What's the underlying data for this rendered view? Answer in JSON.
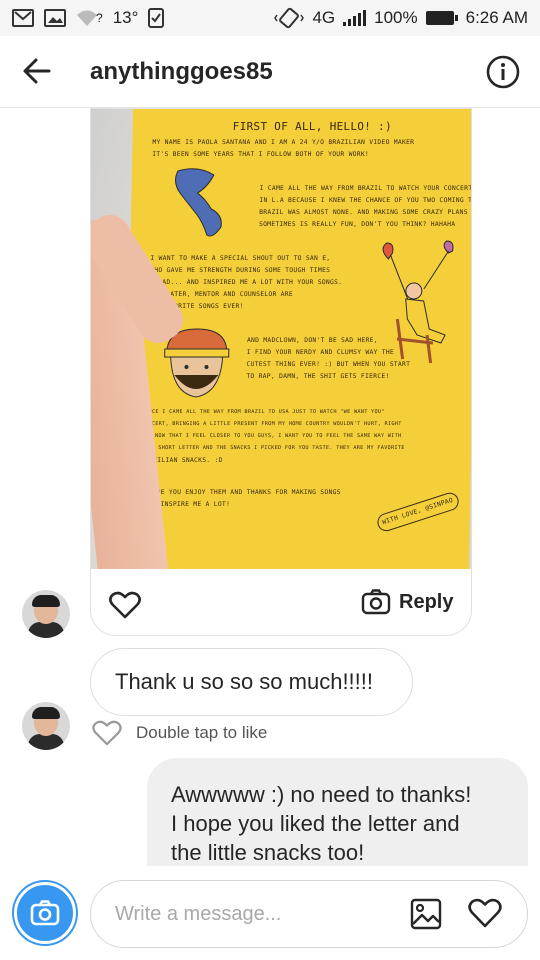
{
  "status_bar": {
    "signal_question": "?",
    "temperature": "13°",
    "network": "4G",
    "battery": "100%",
    "time": "6:26 AM"
  },
  "header": {
    "username": "anythinggoes85",
    "back_icon": "arrow-left-icon",
    "info_icon": "info-circle-icon"
  },
  "letter": {
    "date_line": "",
    "body_lines": [
      "FIRST OF ALL, HELLO! :)",
      "MY NAME IS PAOLA SANTANA AND I AM A 24 Y/O BRAZILIAN VIDEO MAKER",
      "IT'S BEEN SOME YEARS THAT I FOLLOW BOTH OF YOUR WORK!",
      "I CAME ALL THE WAY FROM BRAZIL TO WATCH YOUR CONCERT",
      "IN L.A BECAUSE I KNEW THE CHANCE OF YOU TWO COMING TO",
      "BRAZIL WAS ALMOST NONE. AND MAKING SOME CRAZY PLANS",
      "SOMETIMES IS REALLY FUN, DON'T YOU THINK? HAHAHA",
      "I WANT TO MAKE A SPECIAL SHOUT OUT TO SAN E,",
      "WHO GAVE ME STRENGTH DURING SOME TOUGH TIMES",
      "I HAD... AND INSPIRED ME A LOT WITH YOUR SONGS.",
      "LUVWRATER, MENTOR AND COUNSELOR ARE",
      "MY FAVORITE SONGS EVER!",
      "AND MADCLOWN, DON'T BE SAD HERE,",
      "I FIND YOUR NERDY AND CLUMSY WAY THE",
      "CUTEST THING EVER! :) BUT WHEN YOU START",
      "TO RAP, DAMN, THE SHIT GETS FIERCE!",
      "SINCE I CAME ALL THE WAY FROM BRAZIL TO USA JUST TO WATCH \"WE WANT YOU\"",
      "CONCERT, BRINGING A LITTLE PRESENT FROM MY HOME COUNTRY WOULDN'T HURT, RIGHT",
      "SO, NOW THAT I FEEL CLOSER TO YOU GUYS, I WANT YOU TO FEEL THE SAME WAY WITH",
      "THIS SHORT LETTER AND THE SNACKS I PICKED FOR YOU TASTE. THEY ARE MY FAVORITE",
      "BRAZILIAN SNACKS. :D",
      "I HOPE YOU ENJOY THEM AND THANKS FOR MAKING SONGS",
      "THAT INSPIRE ME A LOT!",
      "WITH LOVE, @SINPAO"
    ]
  },
  "image_message": {
    "heart_icon": "heart-outline-icon",
    "reply_icon": "camera-outline-icon",
    "reply_label": "Reply"
  },
  "messages": {
    "incoming_text": "Thank u so so so much!!!!!",
    "like_hint": "Double tap to like",
    "outgoing_text": "Awwwww :) no need to thanks!\nI hope you liked the letter and\nthe little snacks too!"
  },
  "composer": {
    "camera_icon": "camera-icon",
    "placeholder": "Write a message...",
    "gallery_icon": "gallery-icon",
    "heart_icon": "heart-outline-icon"
  },
  "colors": {
    "accent_blue": "#3897f0",
    "letter_yellow": "#f5cf3a",
    "outgoing_bubble": "#efefef"
  }
}
